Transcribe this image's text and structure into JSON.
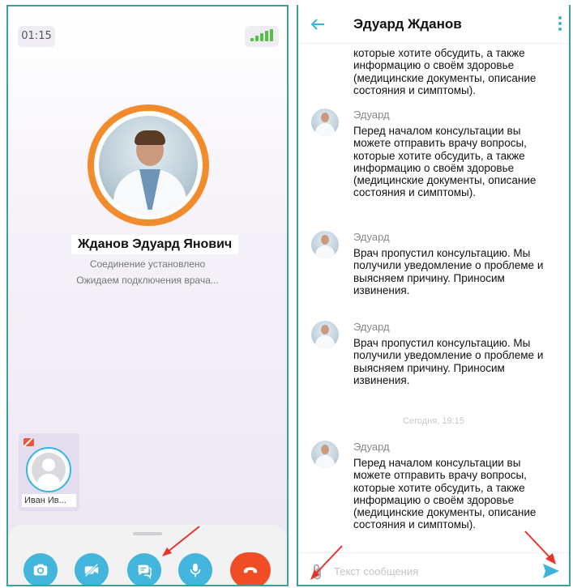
{
  "call": {
    "time": "01:15",
    "doctor_name": "Жданов Эдуард Янович",
    "status_connected": "Соединение установлено",
    "status_waiting": "Ожидаем подключения врача...",
    "self_label": "Иван Ив...",
    "controls": [
      "flip-camera",
      "camera-off",
      "chat",
      "microphone",
      "hang-up"
    ]
  },
  "chat": {
    "title": "Эдуард Жданов",
    "truncated_text": "которые хотите обсудить, а также информацию о своём здоровье (медицинские документы, описание состояния и симптомы).",
    "messages": [
      {
        "sender": "Эдуард",
        "text": "Перед началом консультации вы можете отправить врачу вопросы, которые хотите обсудить, а также информацию о своём здоровье (медицинские документы, описание состояния и симптомы)."
      },
      {
        "sender": "Эдуард",
        "text": "Врач пропустил консультацию. Мы получили уведомление о проблеме и выясняем причину. Приносим извинения."
      },
      {
        "sender": "Эдуард",
        "text": "Врач пропустил консультацию. Мы получили уведомление о проблеме и выясняем причину. Приносим извинения."
      },
      {
        "sender": "Эдуард",
        "text": "Перед началом консультации вы можете отправить врачу вопросы, которые хотите обсудить, а также информацию о своём здоровье (медицинские документы, описание состояния и симптомы)."
      }
    ],
    "date_separator": "Сегодня, 19:15",
    "input_placeholder": "Текст сообщения"
  },
  "colors": {
    "accent": "#44b6dd",
    "hangup": "#f04c26",
    "avatar_ring": "#f28b2b",
    "annotation_arrow": "#e8332a"
  }
}
